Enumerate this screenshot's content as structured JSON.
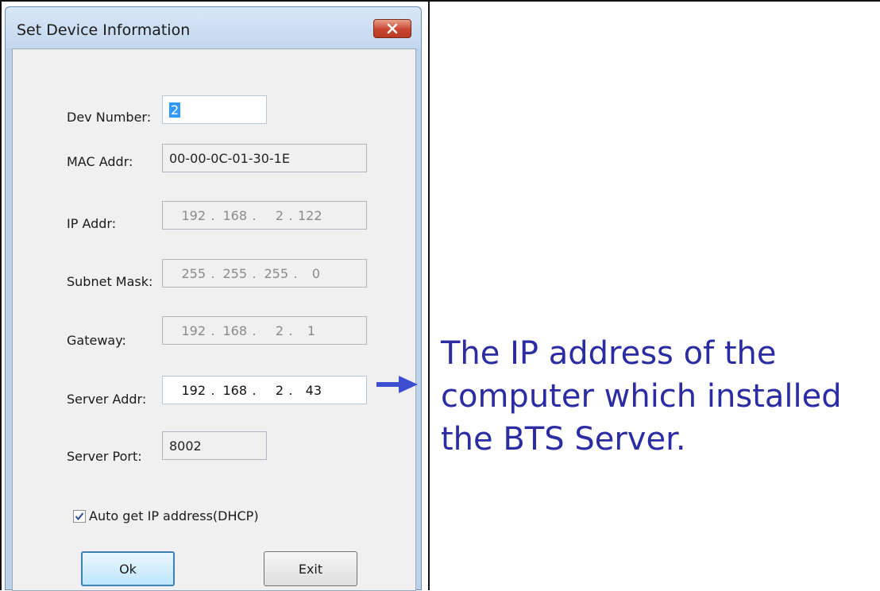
{
  "dialog": {
    "title": "Set Device Information",
    "close_icon": "close-icon"
  },
  "fields": {
    "dev_number": {
      "label": "Dev Number:",
      "value": "2"
    },
    "mac_addr": {
      "label": "MAC Addr:",
      "value": "00-00-0C-01-30-1E"
    },
    "ip_addr": {
      "label": "IP Addr:",
      "octets": [
        "192",
        "168",
        "2",
        "122"
      ]
    },
    "subnet_mask": {
      "label": "Subnet Mask:",
      "octets": [
        "255",
        "255",
        "255",
        "0"
      ]
    },
    "gateway": {
      "label": "Gateway:",
      "octets": [
        "192",
        "168",
        "2",
        "1"
      ]
    },
    "server_addr": {
      "label": "Server Addr:",
      "octets": [
        "192",
        "168",
        "2",
        "43"
      ]
    },
    "server_port": {
      "label": "Server Port:",
      "value": "8002"
    }
  },
  "dhcp": {
    "label": "Auto get IP address(DHCP)",
    "checked": true
  },
  "buttons": {
    "ok": "Ok",
    "exit": "Exit"
  },
  "annotation": {
    "lines": [
      "The IP address of the",
      "computer which installed",
      "the BTS Server."
    ],
    "color": "#2b2ba3"
  }
}
